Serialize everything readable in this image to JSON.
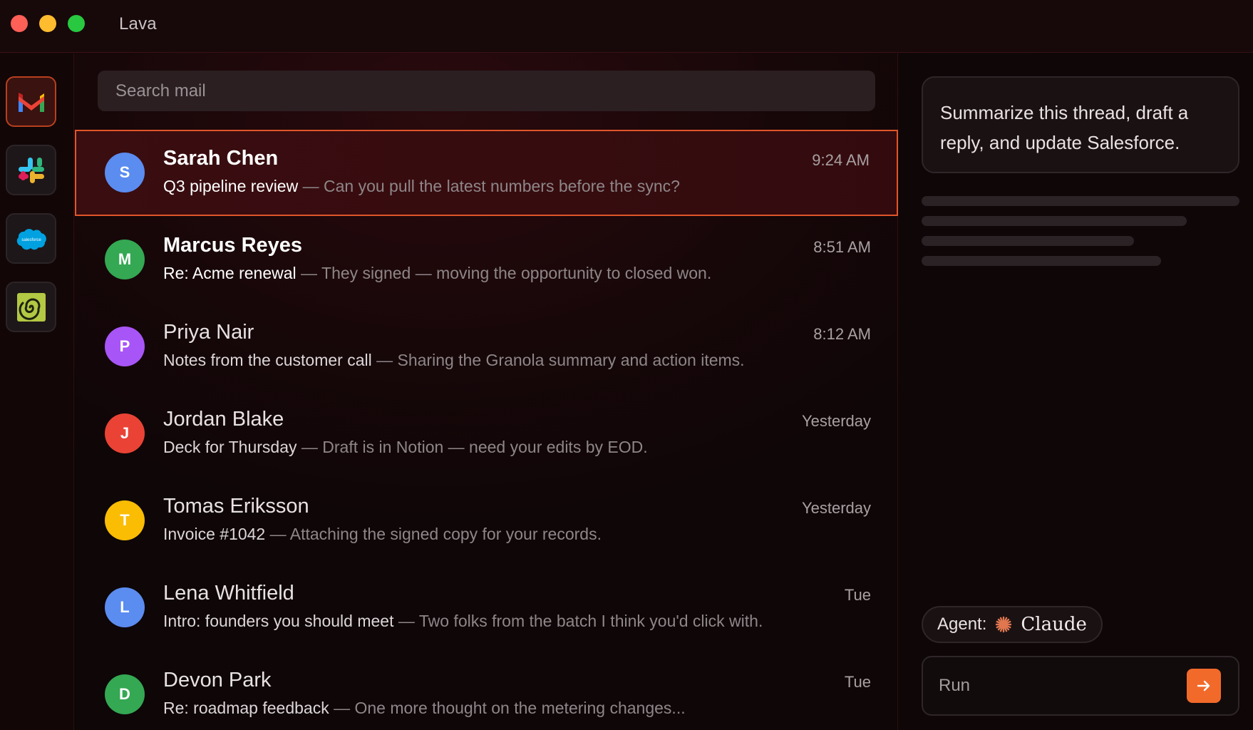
{
  "window": {
    "title": "Lava"
  },
  "rail": {
    "apps": [
      {
        "name": "Gmail",
        "icon": "gmail-icon",
        "active": true
      },
      {
        "name": "Slack",
        "icon": "slack-icon"
      },
      {
        "name": "Salesforce",
        "icon": "salesforce-icon",
        "logo_text": "salesforce"
      },
      {
        "name": "Granola",
        "icon": "granola-icon"
      }
    ]
  },
  "search": {
    "placeholder": "Search mail"
  },
  "emails": [
    {
      "initial": "S",
      "sender": "Sarah Chen",
      "time": "9:24 AM",
      "subject": "Q3 pipeline review",
      "preview": "Can you pull the latest numbers before the sync?",
      "avatar_color": "#5b8cf0",
      "unread": true,
      "selected": true
    },
    {
      "initial": "M",
      "sender": "Marcus Reyes",
      "time": "8:51 AM",
      "subject": "Re: Acme renewal",
      "preview": "They signed — moving the opportunity to closed won.",
      "avatar_color": "#34a853",
      "unread": true
    },
    {
      "initial": "P",
      "sender": "Priya Nair",
      "time": "8:12 AM",
      "subject": "Notes from the customer call",
      "preview": "Sharing the Granola summary and action items.",
      "avatar_color": "#a855f7"
    },
    {
      "initial": "J",
      "sender": "Jordan Blake",
      "time": "Yesterday",
      "subject": "Deck for Thursday",
      "preview": "Draft is in Notion — need your edits by EOD.",
      "avatar_color": "#ea4335"
    },
    {
      "initial": "T",
      "sender": "Tomas Eriksson",
      "time": "Yesterday",
      "subject": "Invoice #1042",
      "preview": "Attaching the signed copy for your records.",
      "avatar_color": "#fbbc04"
    },
    {
      "initial": "L",
      "sender": "Lena Whitfield",
      "time": "Tue",
      "subject": "Intro: founders you should meet",
      "preview": "Two folks from the batch I think you'd click with.",
      "avatar_color": "#5b8cf0"
    },
    {
      "initial": "D",
      "sender": "Devon Park",
      "time": "Tue",
      "subject": "Re: roadmap feedback",
      "preview": "One more thought on the metering changes...",
      "avatar_color": "#34a853"
    }
  ],
  "separator": "—",
  "agent_panel": {
    "prompt": "Summarize this thread, draft a reply, and update Salesforce.",
    "agent_label": "Agent:",
    "agent_name": "Claude",
    "run_placeholder": "Run",
    "accent": "#f26a2a"
  }
}
